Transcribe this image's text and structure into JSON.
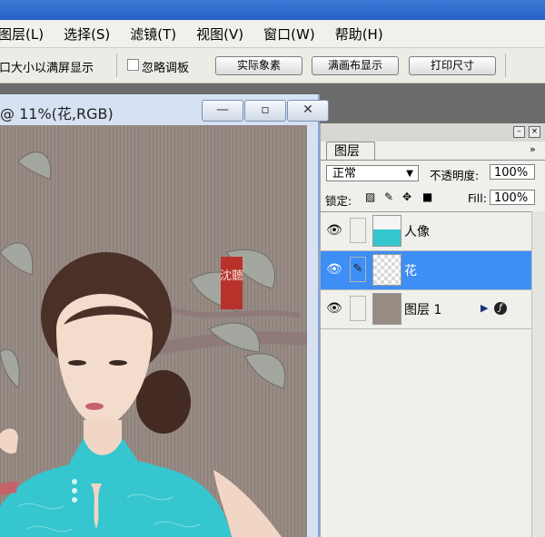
{
  "menu": [
    "图层(L)",
    "选择(S)",
    "滤镜(T)",
    "视图(V)",
    "窗口(W)",
    "帮助(H)"
  ],
  "options": {
    "fit_text": "口大小以满屏显示",
    "ignore_palettes": "忽略调板",
    "actual_pixels": "实际象素",
    "fill_screen": "满画布显示",
    "print_size": "打印尺寸"
  },
  "document": {
    "title": "@ 11%(花,RGB)",
    "minimize": "—",
    "restore": "▫",
    "close": "✕",
    "seal_text": "沈聽"
  },
  "layers_panel": {
    "tab": "图层",
    "blend_mode": "正常",
    "opacity_label": "不透明度:",
    "opacity_value": "100%",
    "lock_label": "锁定:",
    "fill_label": "Fill:",
    "fill_value": "100%",
    "layers": [
      {
        "name": "人像",
        "selected": false
      },
      {
        "name": "花",
        "selected": true
      },
      {
        "name": "图层 1",
        "selected": false
      }
    ]
  },
  "colors": {
    "selection": "#3d8ef5",
    "dress": "#35c6cf",
    "background_paper": "#978b84"
  }
}
